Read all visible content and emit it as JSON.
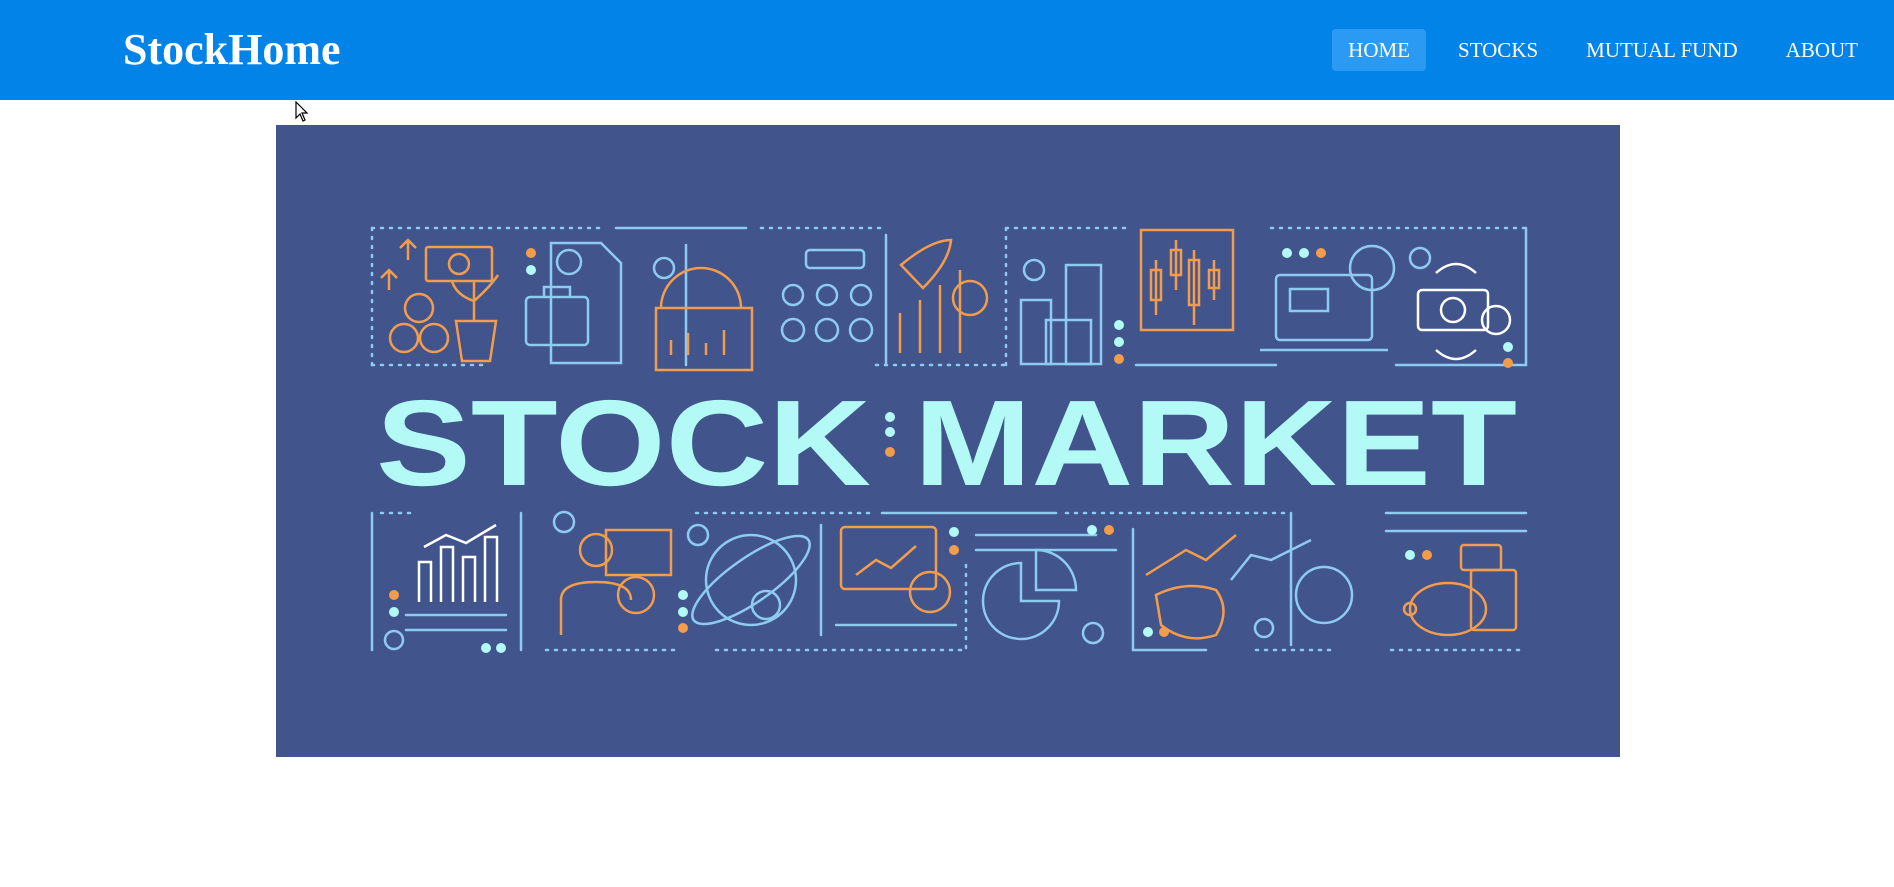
{
  "brand": {
    "name": "StockHome"
  },
  "nav": {
    "items": [
      {
        "label": "HOME",
        "active": true
      },
      {
        "label": "STOCKS",
        "active": false
      },
      {
        "label": "MUTUAL FUND",
        "active": false
      },
      {
        "label": "ABOUT",
        "active": false
      }
    ]
  },
  "hero": {
    "word_left": "STOCK",
    "word_right": "MARKET"
  },
  "colors": {
    "navbar": "#0283e8",
    "nav_active": "#2b9af2",
    "hero_bg": "#41548c",
    "title": "#b3faf7",
    "line_blue": "#8ecbf0",
    "accent_orange": "#f39c4c"
  },
  "icons": [
    "money-plant-icon",
    "briefcase-document-icon",
    "globe-chart-icon",
    "team-money-icon",
    "rocket-growth-icon",
    "buildings-icon",
    "candlestick-icon",
    "laptop-money-icon",
    "money-exchange-icon",
    "bar-chart-icon",
    "investor-icon",
    "globe-check-icon",
    "monitor-chart-icon",
    "pie-chart-icon",
    "bull-icon",
    "bear-icon",
    "piggy-bank-icon"
  ]
}
